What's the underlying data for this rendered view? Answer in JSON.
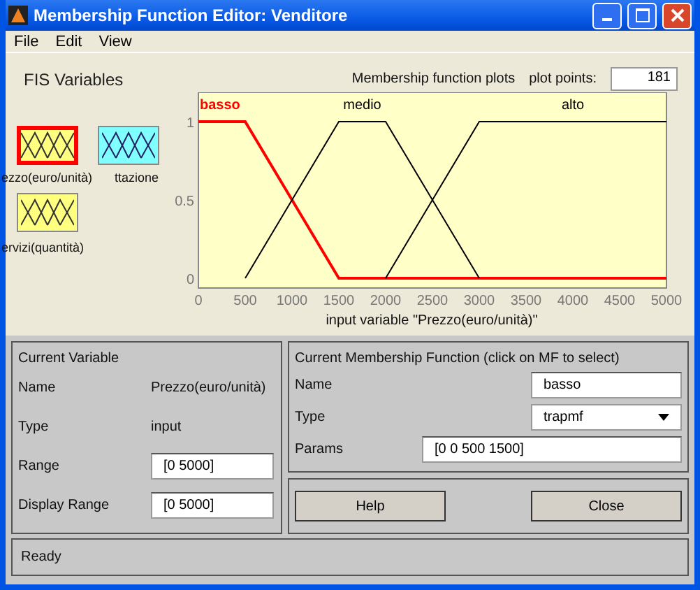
{
  "window": {
    "title": "Membership Function Editor: Venditore"
  },
  "menu": [
    "File",
    "Edit",
    "View"
  ],
  "fis_variables": {
    "title": "FIS Variables",
    "items": [
      {
        "label": "ezzo(euro/unità)",
        "kind": "input",
        "selected": true
      },
      {
        "label": "ttazione",
        "kind": "output",
        "selected": false
      },
      {
        "label": "ervizi(quantità)",
        "kind": "input",
        "selected": false
      }
    ]
  },
  "plot": {
    "title": "Membership function plots",
    "plot_points_label": "plot points:",
    "plot_points": "181",
    "chart_data": {
      "type": "line",
      "xlabel": "input variable \"Prezzo(euro/unità)\"",
      "x": [
        0,
        500,
        1000,
        1500,
        2000,
        2500,
        3000,
        3500,
        4000,
        4500,
        5000
      ],
      "series": [
        {
          "name": "basso",
          "color": "#ff0000",
          "values": [
            1,
            1,
            0.5,
            0,
            0,
            0,
            0,
            0,
            0,
            0,
            0
          ]
        },
        {
          "name": "medio",
          "color": "#000000",
          "values": [
            null,
            0,
            0.5,
            1,
            1,
            0.5,
            0,
            null,
            null,
            null,
            null
          ]
        },
        {
          "name": "alto",
          "color": "#000000",
          "values": [
            null,
            null,
            null,
            null,
            0,
            0.5,
            1,
            1,
            1,
            1,
            1
          ]
        }
      ],
      "xlim": [
        0,
        5000
      ],
      "ylim": [
        -0.0625,
        1.1875
      ],
      "xticks": [
        0,
        500,
        1000,
        1500,
        2000,
        2500,
        3000,
        3500,
        4000,
        4500,
        5000
      ],
      "yticks": [
        0,
        0.5,
        1
      ]
    }
  },
  "current_variable": {
    "title": "Current Variable",
    "rows": [
      {
        "label": "Name",
        "value": "Prezzo(euro/unità)",
        "kind": "text"
      },
      {
        "label": "Type",
        "value": "input",
        "kind": "text"
      },
      {
        "label": "Range",
        "value": "[0 5000]",
        "kind": "field"
      },
      {
        "label": "Display Range",
        "value": "[0 5000]",
        "kind": "field"
      }
    ]
  },
  "current_mf": {
    "title": "Current Membership Function (click on MF to select)",
    "name_label": "Name",
    "name": "basso",
    "type_label": "Type",
    "type": "trapmf",
    "params_label": "Params",
    "params": "[0 0 500 1500]"
  },
  "buttons": [
    "Help",
    "Close"
  ],
  "status": "Ready"
}
